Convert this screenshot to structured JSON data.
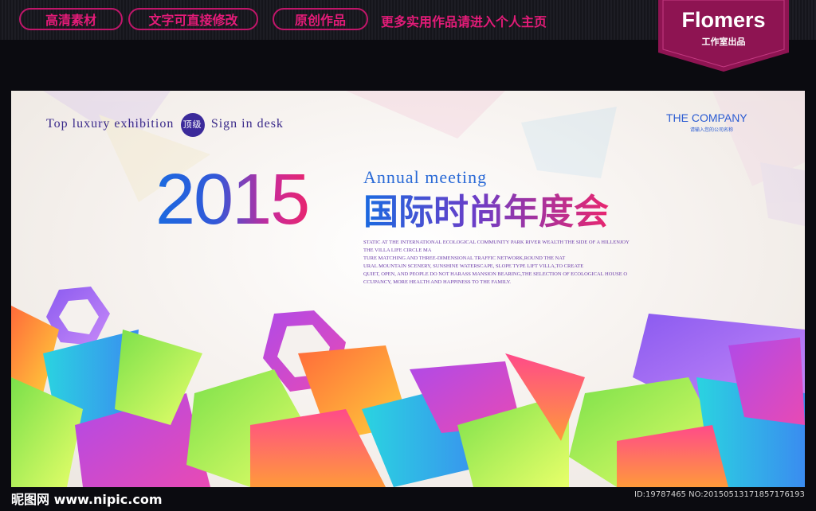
{
  "topbar": {
    "pills": [
      "高清素材",
      "文字可直接修改",
      "原创作品"
    ],
    "promo": "更多实用作品请进入个人主页"
  },
  "badge": {
    "title": "Flomers",
    "subtitle": "工作室出品"
  },
  "poster": {
    "tagline": {
      "lead": "Top luxury exhibition",
      "circle": "顶级",
      "tail": "Sign in desk"
    },
    "company": "THE COMPANY",
    "company_sub": "请输入您的公司名称",
    "year": "2015",
    "annual": "Annual meeting",
    "cn_title": "国际时尚年度会",
    "description": [
      "STATIC AT THE INTERNATIONAL ECOLOGICAL COMMUNITY PARK RIVER WEALTH THE SIDE OF A HILLENJOY",
      "THE VILLA LIFE CIRCLE MA",
      "TURE MATCHING AND THREE-DIMENSIONAL TRAFFIC NETWORK,ROUND THE NAT",
      "URAL MOUNTAIN SCENERY, SUNSHINE WATERSCAPE, SLOPE TYPE LIFT VILLA,TO CREATE",
      "QUIET, OPEN, AND PEOPLE DO NOT HARASS MANSION BEARING,THE SELECTION OF ECOLOGICAL HOUSE O",
      "CCUPANCY, MORE HEALTH AND HAPPINESS TO THE FAMILY."
    ]
  },
  "footer": {
    "watermark": "昵图网 www.nipic.com",
    "id": "ID:19787465 NO:20150513171857176193"
  },
  "colors": {
    "accent": "#e31b78",
    "badge": "#8e1452",
    "brand_blue": "#2a5bd2"
  }
}
